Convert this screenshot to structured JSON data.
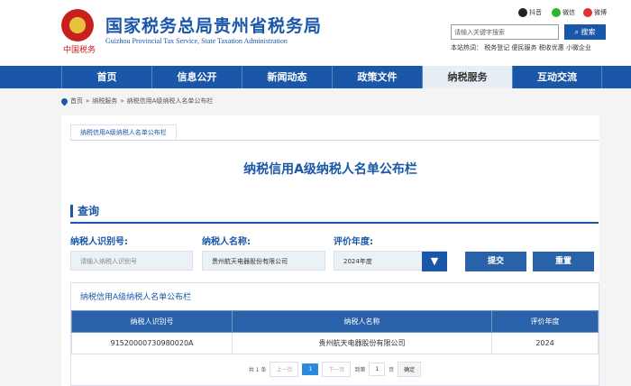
{
  "header": {
    "title": "国家税务总局贵州省税务局",
    "subtitle": "Guizhou Provincial Tax Service, State Taxation Administration",
    "slogan": "中国税务",
    "social": [
      "抖音",
      "微信",
      "微博"
    ],
    "search_placeholder": "请输入关键字搜索",
    "search_button": "搜索",
    "hot_label": "本站热词：",
    "hot_words": [
      "税务登记",
      "便民服务",
      "税收优惠",
      "小微企业"
    ]
  },
  "nav": [
    "首页",
    "信息公开",
    "新闻动态",
    "政策文件",
    "纳税服务",
    "互动交流"
  ],
  "breadcrumb": [
    "首页",
    "纳税服务",
    "纳税信用A级纳税人名单公布栏"
  ],
  "tab": "纳税信用A级纳税人名单公布栏",
  "page_title": "纳税信用A级纳税人名单公布栏",
  "query": {
    "heading": "查询",
    "id_label": "纳税人识别号:",
    "id_placeholder": "请输入纳税人识别号",
    "name_label": "纳税人名称:",
    "name_value": "贵州航天电器股份有限公司",
    "year_label": "评价年度:",
    "year_value": "2024年度",
    "submit": "提交",
    "reset": "重置"
  },
  "results": {
    "title": "纳税信用A级纳税人名单公布栏",
    "columns": [
      "纳税人识别号",
      "纳税人名称",
      "评价年度"
    ],
    "rows": [
      [
        "91520000730980020A",
        "贵州航天电器股份有限公司",
        "2024"
      ]
    ]
  },
  "pager": {
    "total": "共 1 条",
    "prev": "上一页",
    "current": "1",
    "next": "下一页",
    "goto": "到第",
    "page_value": "1",
    "page_unit": "页",
    "confirm": "确定"
  }
}
